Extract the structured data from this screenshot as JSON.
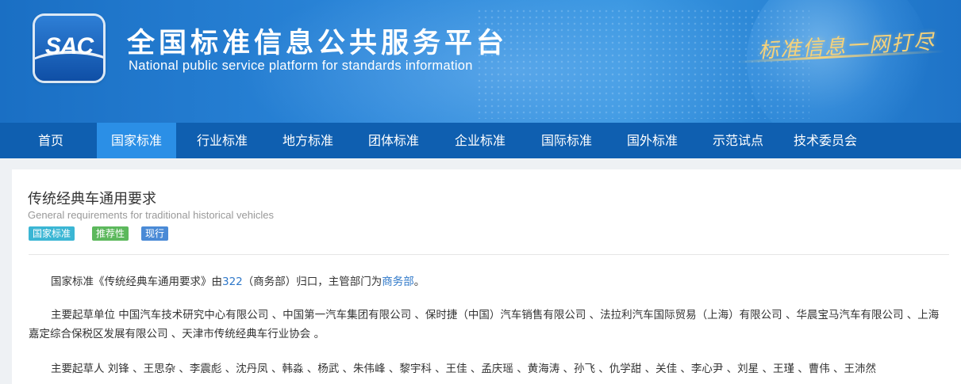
{
  "header": {
    "logo_text": "SAC",
    "title_cn": "全国标准信息公共服务平台",
    "title_en": "National public service platform  for standards information",
    "slogan": "标准信息一网打尽"
  },
  "nav": {
    "items": [
      {
        "label": "首页"
      },
      {
        "label": "国家标准"
      },
      {
        "label": "行业标准"
      },
      {
        "label": "地方标准"
      },
      {
        "label": "团体标准"
      },
      {
        "label": "企业标准"
      },
      {
        "label": "国际标准"
      },
      {
        "label": "国外标准"
      },
      {
        "label": "示范试点"
      },
      {
        "label": "技术委员会"
      }
    ],
    "active_index": 1
  },
  "standard": {
    "title_cn": "传统经典车通用要求",
    "title_en": "General requirements for traditional historical vehicles",
    "tags": [
      "国家标准",
      "推荐性",
      "现行"
    ],
    "ownership": {
      "prefix": "国家标准《传统经典车通用要求》由",
      "committee_link": "322",
      "middle": "（商务部）归口，主管部门为",
      "department_link": "商务部",
      "suffix": "。"
    },
    "drafting_units": "主要起草单位 中国汽车技术研究中心有限公司 、中国第一汽车集团有限公司 、保时捷（中国）汽车销售有限公司 、法拉利汽车国际贸易（上海）有限公司 、华晨宝马汽车有限公司 、上海嘉定综合保税区发展有限公司 、天津市传统经典车行业协会 。",
    "drafters": "主要起草人 刘锋 、王思杂 、李震彪 、沈丹凤 、韩淼 、杨武 、朱伟峰 、黎宇科 、王佳 、孟庆瑶 、黄海涛 、孙飞 、仇学甜 、关佳 、李心尹 、刘星 、王瑾 、曹伟 、王沛然"
  },
  "colors": {
    "nav_bg": "#0f5fb0",
    "nav_active": "#2b8fe6",
    "link": "#2f78c9"
  }
}
